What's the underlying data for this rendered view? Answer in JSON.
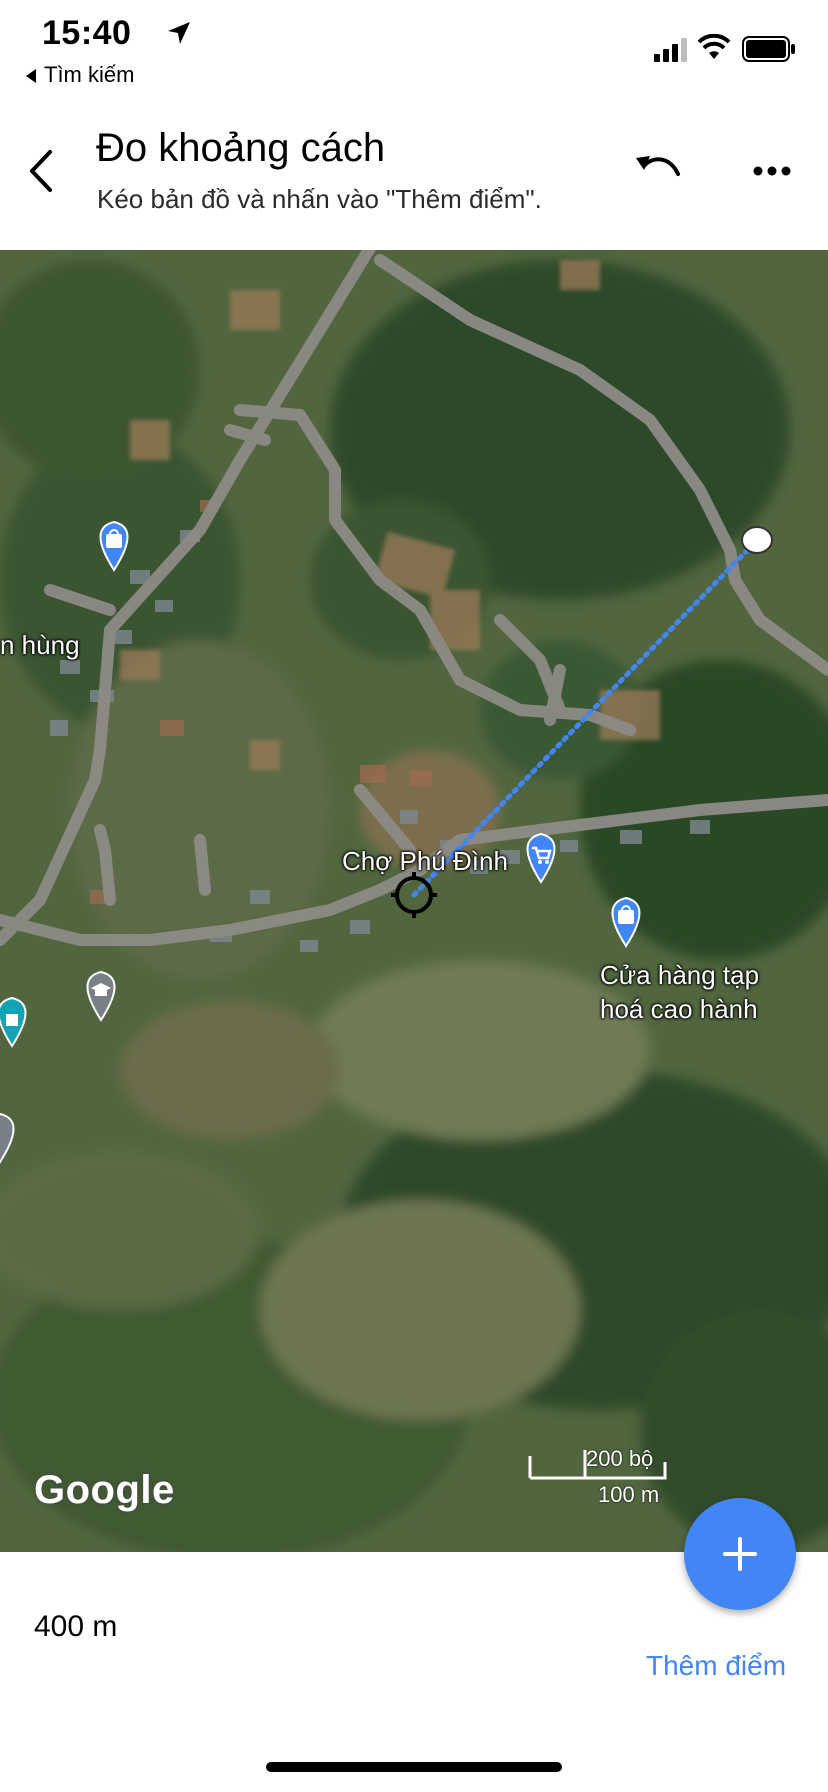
{
  "status_bar": {
    "time": "15:40",
    "back_app": "Tìm kiếm"
  },
  "header": {
    "title": "Đo khoảng cách",
    "subtitle": "Kéo bản đồ và nhấn vào \"Thêm điểm\"."
  },
  "map": {
    "type": "satellite",
    "labels": {
      "shop_left": "n hùng",
      "market": "Chợ Phú Đình",
      "store_line1": "Cửa hàng tạp",
      "store_line2": "hoá cao hành"
    },
    "logo": "Google",
    "scale_imperial": "200 bộ",
    "scale_metric": "100 m",
    "accent_color": "#4285f4"
  },
  "bottom": {
    "distance": "400 m",
    "add_point": "Thêm điểm"
  }
}
